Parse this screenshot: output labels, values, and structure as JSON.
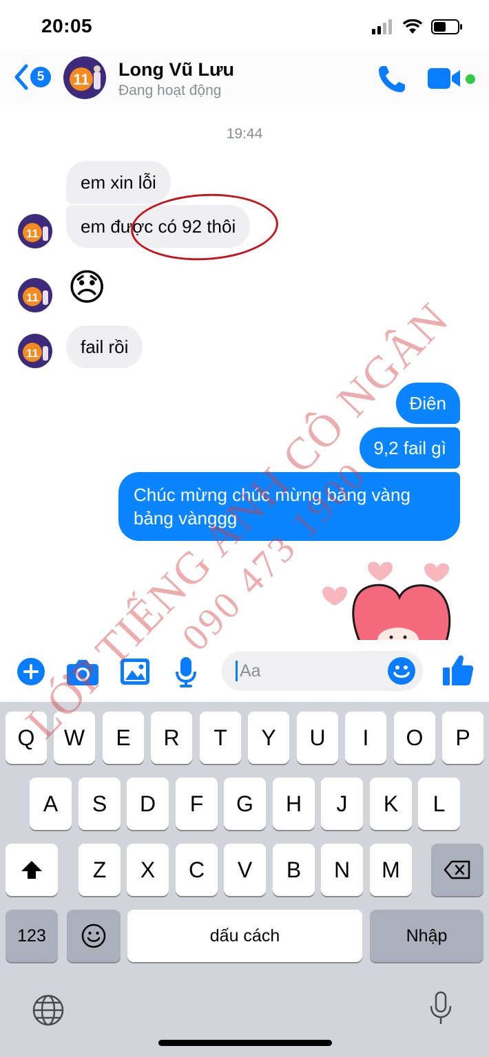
{
  "status_bar": {
    "time": "20:05"
  },
  "header": {
    "back_count": "5",
    "contact_name": "Long Vũ Lưu",
    "contact_status": "Đang hoạt động",
    "avatar_text": "11"
  },
  "chat": {
    "timestamp": "19:44",
    "incoming": [
      "em xin lỗi",
      "em được có 92 thôi",
      "😞",
      "fail rồi"
    ],
    "outgoing": [
      "Điên",
      "9,2 fail gì",
      "Chúc mừng chúc mừng bảng vàng",
      "bảng vànggg"
    ]
  },
  "composer": {
    "placeholder": "Aa"
  },
  "keyboard": {
    "row1": [
      "Q",
      "W",
      "E",
      "R",
      "T",
      "Y",
      "U",
      "I",
      "O",
      "P"
    ],
    "row2": [
      "A",
      "S",
      "D",
      "F",
      "G",
      "H",
      "J",
      "K",
      "L"
    ],
    "row3": [
      "Z",
      "X",
      "C",
      "V",
      "B",
      "N",
      "M"
    ],
    "numbers_key": "123",
    "space_label": "dấu cách",
    "return_label": "Nhập"
  },
  "watermark": {
    "line1": "LỚP TIẾNG ANH CÔ NGÂN",
    "line2": "090 473 1900"
  },
  "colors": {
    "accent": "#0a84ff",
    "incoming_bubble": "#efeff1",
    "annotation": "#c4151c",
    "online": "#31cc46"
  }
}
